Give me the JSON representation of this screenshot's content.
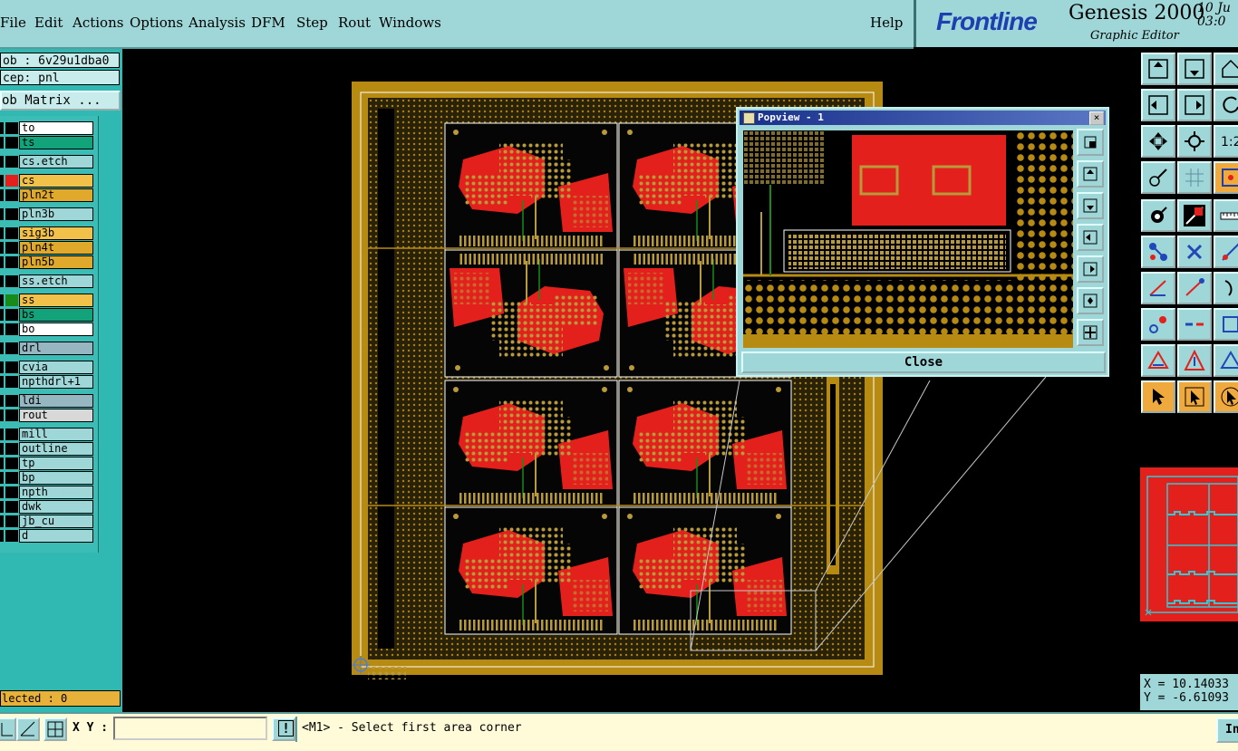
{
  "menu": {
    "items": [
      "File",
      "Edit",
      "Actions",
      "Options",
      "Analysis",
      "DFM",
      "Step",
      "Rout",
      "Windows"
    ],
    "help": "Help"
  },
  "brand": {
    "logo": "Frontline",
    "product": "Genesis 2000",
    "subtitle": "Graphic Editor",
    "date_line1": "10 Ju",
    "date_line2": "03:0"
  },
  "left": {
    "job": "ob : 6v29u1dba0",
    "step": "cep: pnl",
    "matrix_button": "ob Matrix ...",
    "selected": "lected : 0"
  },
  "layers": [
    {
      "name": "to",
      "bg": "#ffffff"
    },
    {
      "name": "ts",
      "bg": "#13a37b"
    },
    {
      "name": "cs.etch",
      "bg": "#9fd7d8"
    },
    {
      "name": "cs",
      "bg": "#f2c14a",
      "swatch": "#e4201c"
    },
    {
      "name": "pln2t",
      "bg": "#e0a92c"
    },
    {
      "name": "pln3b",
      "bg": "#9fd7d8"
    },
    {
      "name": "sig3b",
      "bg": "#f2c14a"
    },
    {
      "name": "pln4t",
      "bg": "#e0a92c"
    },
    {
      "name": "pln5b",
      "bg": "#e0a92c"
    },
    {
      "name": "ss.etch",
      "bg": "#9fd7d8"
    },
    {
      "name": "ss",
      "bg": "#f2c14a",
      "swatch": "#178a1a"
    },
    {
      "name": "bs",
      "bg": "#13a37b"
    },
    {
      "name": "bo",
      "bg": "#ffffff"
    },
    {
      "name": "drl",
      "bg": "#96b6c2"
    },
    {
      "name": "cvia",
      "bg": "#9fd7d8"
    },
    {
      "name": "npthdrl+1",
      "bg": "#9fd7d8"
    },
    {
      "name": "ldi",
      "bg": "#96b6c2"
    },
    {
      "name": "rout",
      "bg": "#d8d8d8"
    },
    {
      "name": "mill",
      "bg": "#9fd7d8"
    },
    {
      "name": "outline",
      "bg": "#9fd7d8"
    },
    {
      "name": "tp",
      "bg": "#9fd7d8"
    },
    {
      "name": "bp",
      "bg": "#9fd7d8"
    },
    {
      "name": "npth",
      "bg": "#9fd7d8"
    },
    {
      "name": "dwk",
      "bg": "#9fd7d8"
    },
    {
      "name": "jb_cu",
      "bg": "#9fd7d8"
    },
    {
      "name": "d",
      "bg": "#9fd7d8"
    }
  ],
  "popview": {
    "title": "Popview - 1",
    "close_label": "Close",
    "close_x": "×"
  },
  "coords": {
    "x": "X = 10.14033",
    "y": "Y = -6.61093"
  },
  "statusbar": {
    "xy_label": "X Y :",
    "xy_value": "",
    "message": "<M1> - Select first area corner",
    "right_button": "In",
    "alert_icon": "!"
  },
  "colors": {
    "panel": "#9fd7d8",
    "copper": "#b78a12",
    "red": "#e4201c",
    "status": "#fffbd8"
  }
}
